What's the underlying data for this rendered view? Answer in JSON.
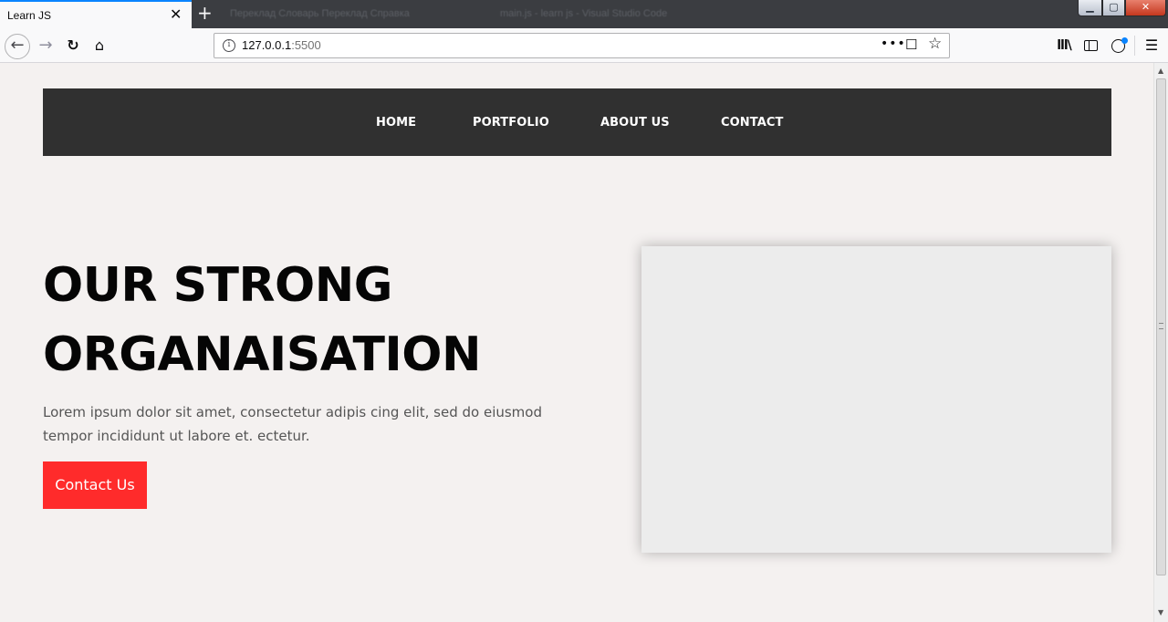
{
  "browser": {
    "tab_title": "Learn JS",
    "tab_close": "✕",
    "new_tab": "+",
    "background_tabs": "Переклад   Словарь   Переклад   Справка",
    "window_title": "main.js - learn js - Visual Studio Code",
    "url_host": "127.0.0.1",
    "url_port": ":5500",
    "info_glyph": "i",
    "more_glyph": "•••",
    "pocket_glyph": "☐",
    "star_glyph": "☆",
    "back_glyph": "←",
    "forward_glyph": "→",
    "reload_glyph": "↻",
    "home_glyph": "⌂",
    "library_glyph": "lll\\",
    "menu_glyph": "☰",
    "min_glyph": "▁",
    "max_glyph": "▢",
    "close_glyph": "✕",
    "scroll_up_glyph": "▲",
    "scroll_down_glyph": "▼"
  },
  "nav": {
    "items": [
      {
        "label": "HOME"
      },
      {
        "label": "PORTFOLIO"
      },
      {
        "label": "ABOUT US"
      },
      {
        "label": "CONTACT"
      }
    ]
  },
  "hero": {
    "title_line1": "OUR STRONG",
    "title_line2": "ORGANAISATION",
    "text": "Lorem ipsum dolor sit amet, consectetur adipis cing elit, sed do eiusmod tempor incididunt ut labore et. ectetur.",
    "button_label": "Contact Us"
  },
  "colors": {
    "nav_background": "#303030",
    "button_background": "#ff2b2b",
    "page_background": "#f4f1f0",
    "image_placeholder": "#ececec"
  }
}
